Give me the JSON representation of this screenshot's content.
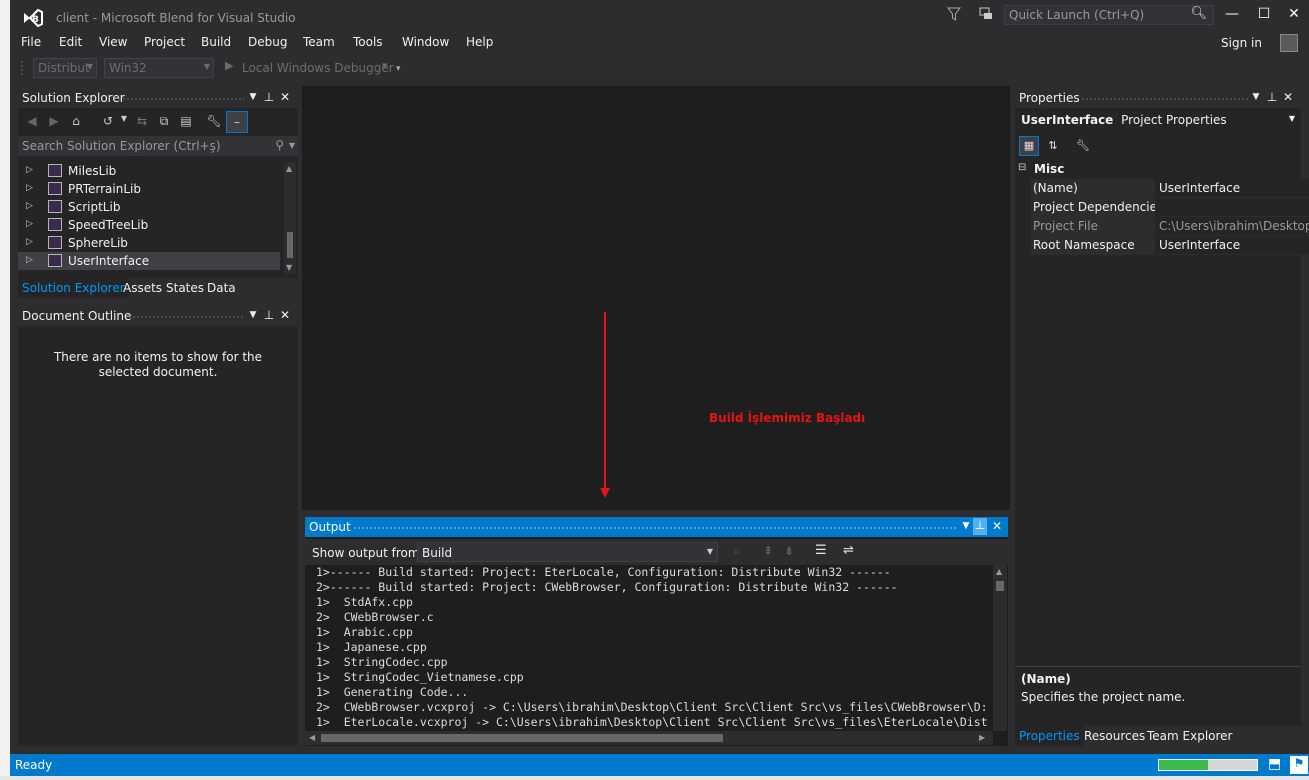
{
  "window": {
    "title": "client - Microsoft Blend for Visual Studio",
    "quick_launch_placeholder": "Quick Launch (Ctrl+Q)",
    "minimize": "—",
    "maximize": "☐",
    "close": "✕"
  },
  "menu": {
    "items": [
      "File",
      "Edit",
      "View",
      "Project",
      "Build",
      "Debug",
      "Team",
      "Tools",
      "Window",
      "Help"
    ],
    "sign_in": "Sign in"
  },
  "toolbar": {
    "configuration": "Distribut",
    "platform": "Win32",
    "debugger": "Local Windows Debugger"
  },
  "solution_explorer": {
    "title": "Solution Explorer",
    "search_placeholder": "Search Solution Explorer (Ctrl+ş)",
    "items": [
      {
        "label": "MilesLib"
      },
      {
        "label": "PRTerrainLib"
      },
      {
        "label": "ScriptLib"
      },
      {
        "label": "SpeedTreeLib"
      },
      {
        "label": "SphereLib"
      },
      {
        "label": "UserInterface"
      }
    ],
    "tabs": [
      "Solution Explorer",
      "Assets",
      "States",
      "Data"
    ]
  },
  "document_outline": {
    "title": "Document Outline",
    "empty_message": "There are no items to show for the selected document."
  },
  "annotation": {
    "text": "Build İşlemimiz Başladı",
    "color": "#e51414"
  },
  "output": {
    "title": "Output",
    "show_from_label": "Show output from:",
    "show_from_value": "Build",
    "lines": [
      "1>------ Build started: Project: EterLocale, Configuration: Distribute Win32 ------",
      "2>------ Build started: Project: CWebBrowser, Configuration: Distribute Win32 ------",
      "1>  StdAfx.cpp",
      "2>  CWebBrowser.c",
      "1>  Arabic.cpp",
      "1>  Japanese.cpp",
      "1>  StringCodec.cpp",
      "1>  StringCodec_Vietnamese.cpp",
      "1>  Generating Code...",
      "2>  CWebBrowser.vcxproj -> C:\\Users\\ibrahim\\Desktop\\Client Src\\Client Src\\vs_files\\CWebBrowser\\D:",
      "1>  EterLocale.vcxproj -> C:\\Users\\ibrahim\\Desktop\\Client Src\\Client Src\\vs_files\\EterLocale\\Dist"
    ]
  },
  "properties": {
    "title": "Properties",
    "object_name": "UserInterface",
    "object_type": "Project Properties",
    "category": "Misc",
    "rows": [
      {
        "name": "(Name)",
        "value": "UserInterface"
      },
      {
        "name": "Project Dependencies",
        "value": ""
      },
      {
        "name": "Project File",
        "value": "C:\\Users\\ibrahim\\Desktop\\"
      },
      {
        "name": "Root Namespace",
        "value": "UserInterface"
      }
    ],
    "description_title": "(Name)",
    "description_text": "Specifies the project name.",
    "tabs": [
      "Properties",
      "Resources",
      "Team Explorer"
    ]
  },
  "status": {
    "text": "Ready",
    "progress": 0.5
  },
  "colors": {
    "accent": "#007acc",
    "background": "#2d2d30",
    "panel": "#252526"
  }
}
